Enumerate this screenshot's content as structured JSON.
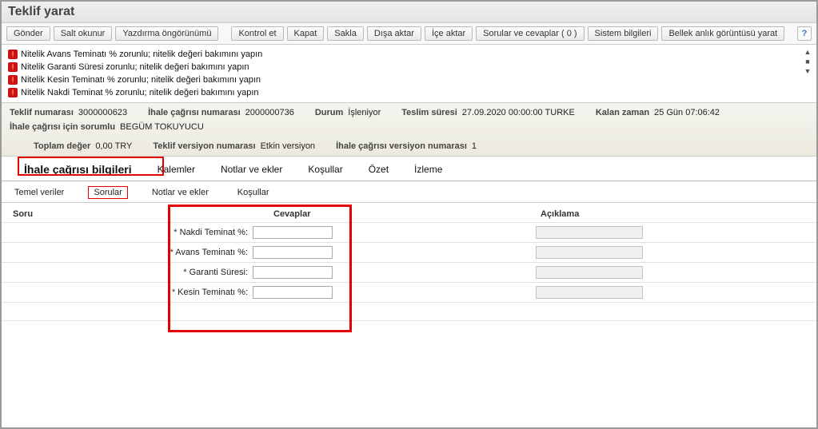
{
  "title": "Teklif yarat",
  "toolbar": {
    "gonder": "Gönder",
    "salt_okunur": "Salt okunur",
    "yazdirma": "Yazdırma öngörünümü",
    "kontrol_et": "Kontrol et",
    "kapat": "Kapat",
    "sakla": "Sakla",
    "disa_aktar": "Dışa aktar",
    "ice_aktar": "İçe aktar",
    "sorular": "Sorular ve cevaplar ( 0 )",
    "sistem": "Sistem bilgileri",
    "bellek": "Bellek anlık görüntüsü yarat"
  },
  "errors": [
    "Nitelik Avans Teminatı % zorunlu; nitelik değeri bakımını yapın",
    "Nitelik Garanti Süresi zorunlu; nitelik değeri bakımını yapın",
    "Nitelik Kesin Teminatı % zorunlu; nitelik değeri bakımını yapın",
    "Nitelik Nakdi Teminat % zorunlu; nitelik değeri bakımını yapın"
  ],
  "info": {
    "teklif_no_lbl": "Teklif numarası",
    "teklif_no": "3000000623",
    "ihale_no_lbl": "İhale çağrısı numarası",
    "ihale_no": "2000000736",
    "durum_lbl": "Durum",
    "durum": "İşleniyor",
    "teslim_lbl": "Teslim süresi",
    "teslim": "27.09.2020 00:00:00 TURKE",
    "kalan_lbl": "Kalan zaman",
    "kalan": "25 Gün 07:06:42",
    "sorumlu_lbl": "İhale çağrısı için sorumlu",
    "sorumlu": "BEGÜM TOKUYUCU",
    "toplam_lbl": "Toplam değer",
    "toplam": "0,00 TRY",
    "teklif_ver_lbl": "Teklif versiyon numarası",
    "teklif_ver": "Etkin versiyon",
    "ihale_ver_lbl": "İhale çağrısı versiyon numarası",
    "ihale_ver": "1"
  },
  "main_tabs": {
    "bilgi": "İhale çağrısı bilgileri",
    "kalemler": "Kalemler",
    "notlar": "Notlar ve ekler",
    "kosullar": "Koşullar",
    "ozet": "Özet",
    "izleme": "İzleme"
  },
  "sub_tabs": {
    "temel": "Temel veriler",
    "sorular": "Sorular",
    "notlar": "Notlar ve ekler",
    "kosullar": "Koşullar"
  },
  "columns": {
    "soru": "Soru",
    "cevaplar": "Cevaplar",
    "aciklama": "Açıklama"
  },
  "questions": [
    {
      "label": "Nakdi Teminat %:"
    },
    {
      "label": "Avans Teminatı %:"
    },
    {
      "label": "Garanti Süresi:"
    },
    {
      "label": "Kesin Teminatı %:"
    }
  ]
}
